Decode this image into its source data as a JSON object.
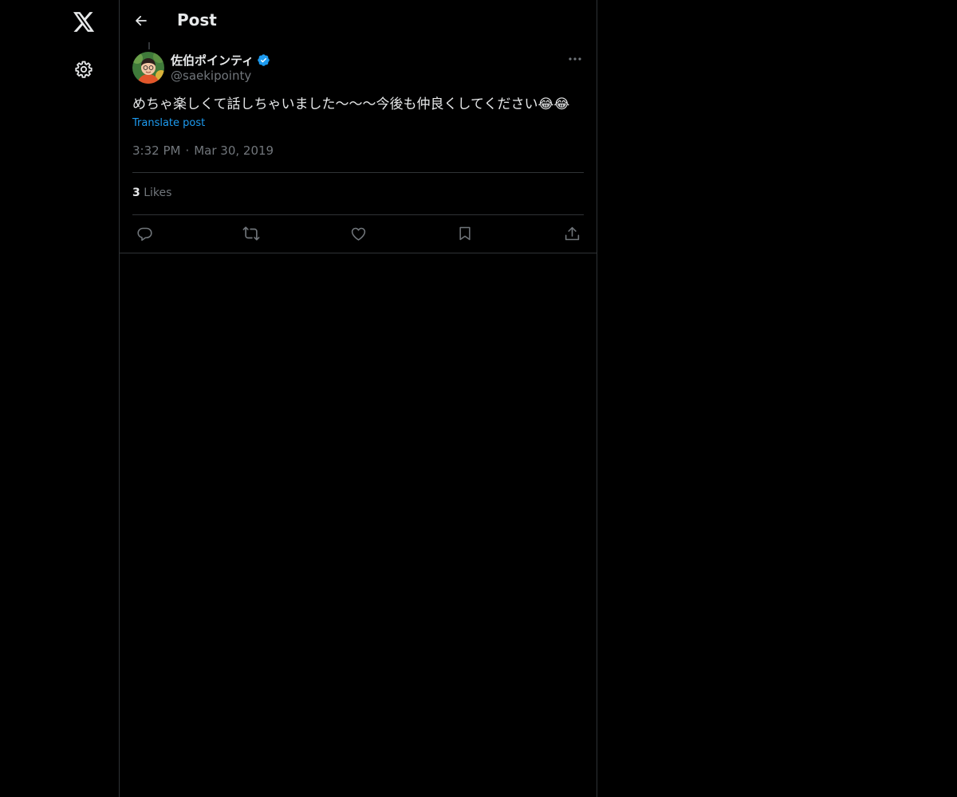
{
  "nav": {
    "logo_icon": "x-logo-icon",
    "settings_icon": "gear-icon"
  },
  "header": {
    "title": "Post",
    "back_icon": "arrow-left-icon"
  },
  "tweet": {
    "author": {
      "display_name": "佐伯ポインティ",
      "handle": "@saekipointy",
      "verified": true
    },
    "text": "めちゃ楽しくて話しちゃいました〜〜〜今後も仲良くしてください😂😂",
    "translate_label": "Translate post",
    "time": "3:32 PM",
    "separator": "·",
    "date": "Mar 30, 2019",
    "likes_count": "3",
    "likes_label": "Likes"
  },
  "actions": [
    "reply-icon",
    "retweet-icon",
    "like-icon",
    "bookmark-icon",
    "share-icon"
  ],
  "colors": {
    "background": "#000000",
    "text": "#e7e9ea",
    "muted": "#71767b",
    "border": "#2f3336",
    "accent": "#1d9bf0"
  }
}
